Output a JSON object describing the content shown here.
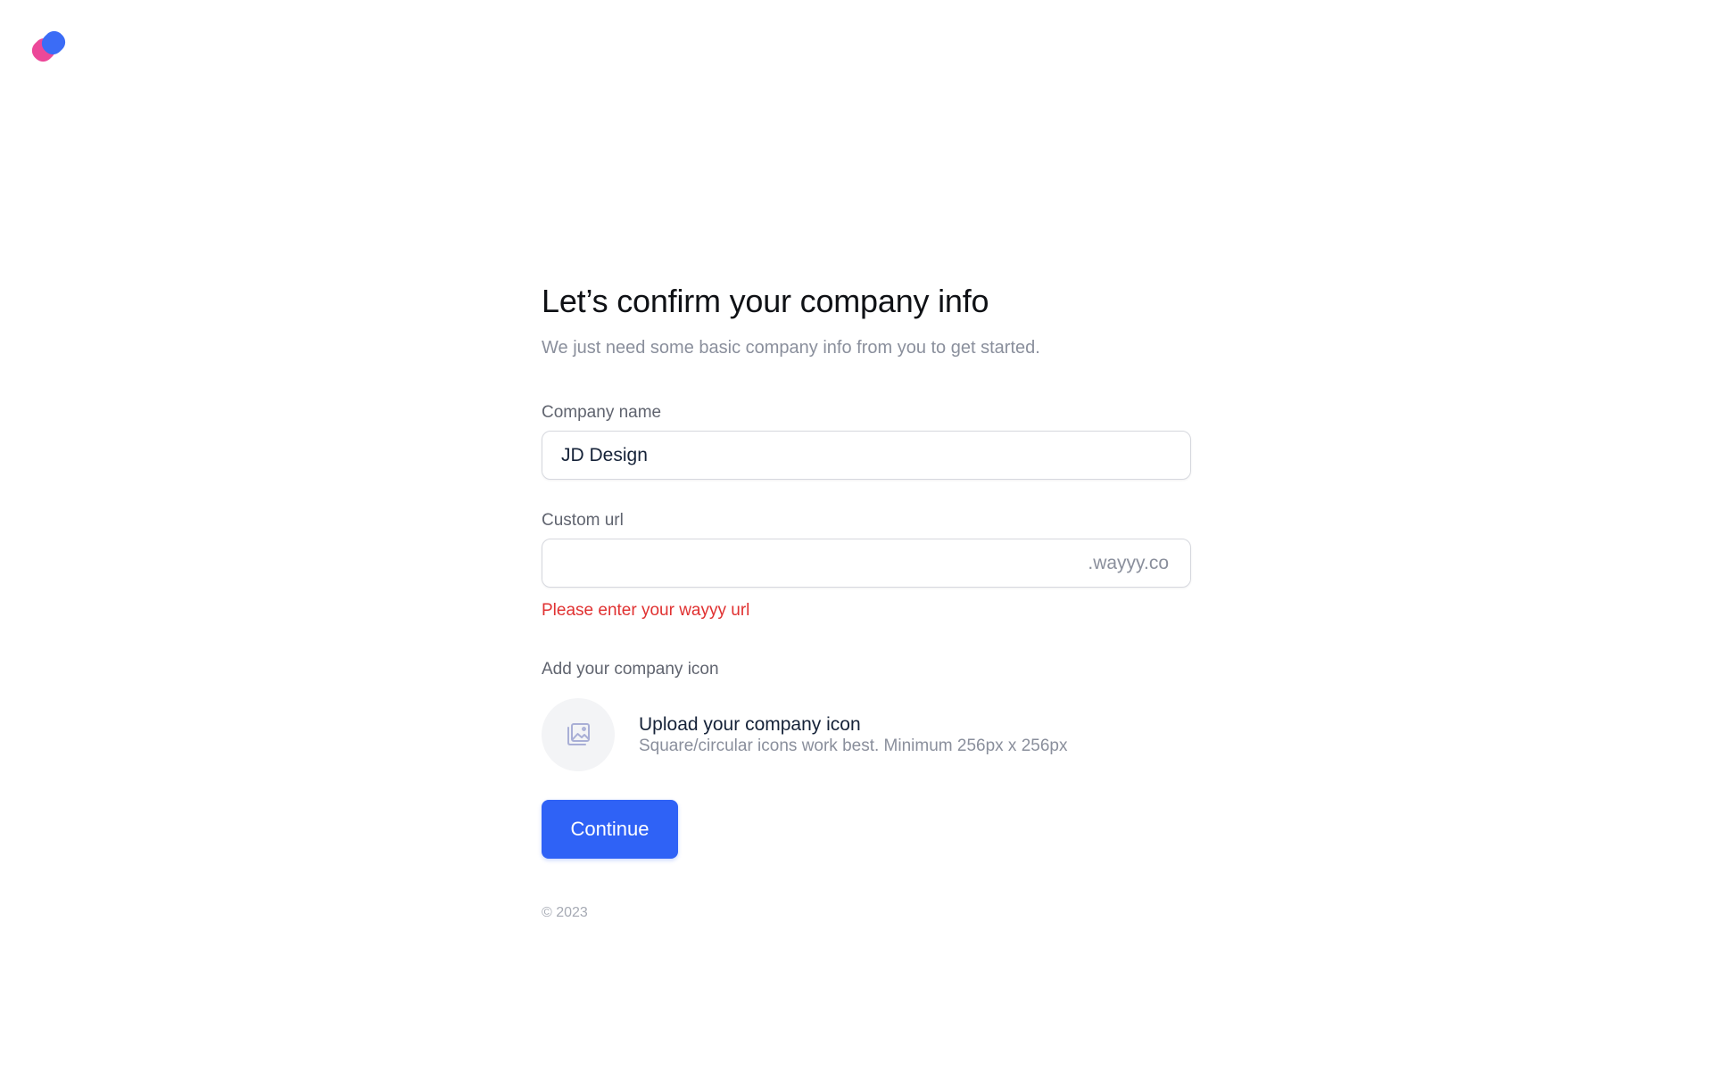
{
  "brand": {
    "logo_icon": "brand-logo-icon",
    "colors": {
      "pink": "#ec4899",
      "blue": "#3b6cf6"
    }
  },
  "header": {
    "title": "Let’s confirm your company info",
    "subtitle": "We just need some basic company info from you to get started."
  },
  "form": {
    "company_name": {
      "label": "Company name",
      "value": "JD Design"
    },
    "custom_url": {
      "label": "Custom url",
      "value": "",
      "suffix": ".wayyy.co",
      "error": "Please enter your wayyy url"
    },
    "company_icon": {
      "label": "Add your company icon",
      "icon": "image-icon",
      "upload_title": "Upload your company icon",
      "upload_hint": "Square/circular icons work best. Minimum 256px x 256px"
    },
    "continue_label": "Continue"
  },
  "footer": {
    "copyright": "© 2023"
  },
  "colors": {
    "accent": "#2f62f6",
    "error": "#e03131"
  }
}
